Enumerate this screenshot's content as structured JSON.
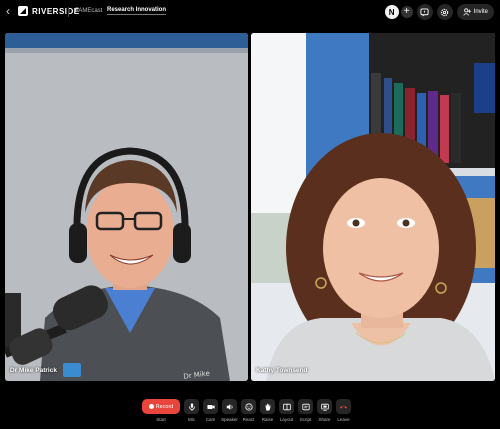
{
  "app": {
    "brand": "RIVERSIDE",
    "show": "FAMEcast",
    "episode": "Research Innovation",
    "back_label": "‹"
  },
  "header": {
    "avatar_initial": "N",
    "add_label": "+",
    "invite_label": "Invite"
  },
  "participants": [
    {
      "name": "Dr Mike Patrick"
    },
    {
      "name": "Kathy Townsend"
    }
  ],
  "toolbar": {
    "record_label": "Record",
    "start_label": "Start",
    "tools": [
      {
        "label": "Mic",
        "icon": "mic-icon"
      },
      {
        "label": "Cam",
        "icon": "camera-icon"
      },
      {
        "label": "Speaker",
        "icon": "speaker-icon"
      },
      {
        "label": "React",
        "icon": "react-icon"
      },
      {
        "label": "Raise",
        "icon": "hand-icon"
      },
      {
        "label": "Layout",
        "icon": "layout-icon"
      },
      {
        "label": "Script",
        "icon": "script-icon"
      },
      {
        "label": "Share",
        "icon": "share-icon"
      },
      {
        "label": "Leave",
        "icon": "leave-icon"
      }
    ]
  },
  "colors": {
    "record": "#e8453c",
    "leave": "#e8453c",
    "background": "#000000",
    "button": "#262626"
  }
}
